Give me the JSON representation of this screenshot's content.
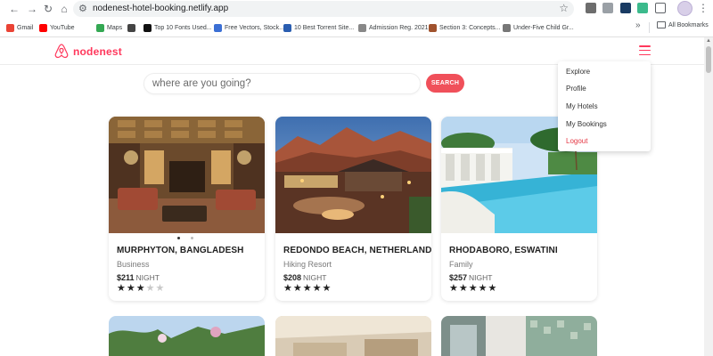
{
  "browser": {
    "url": "nodenest-hotel-booking.netlify.app",
    "bookmarks": [
      {
        "label": "Gmail",
        "color": "#ea4335"
      },
      {
        "label": "YouTube",
        "color": "#ff0000"
      },
      {
        "label": "Maps",
        "color": "#34a853"
      },
      {
        "label": "",
        "color": "#444444"
      },
      {
        "label": "Top 10 Fonts Used...",
        "color": "#111111"
      },
      {
        "label": "Free Vectors, Stock...",
        "color": "#3b6fd4"
      },
      {
        "label": "10 Best Torrent Site...",
        "color": "#2a5db0"
      },
      {
        "label": "Admission Reg. 2021",
        "color": "#888888"
      },
      {
        "label": "Section 3: Concepts...",
        "color": "#a0522d"
      },
      {
        "label": "Under-Five Child Gr...",
        "color": "#777777"
      }
    ],
    "all_bookmarks": "All Bookmarks",
    "more": "»"
  },
  "app": {
    "logo_text": "nodenest",
    "brand_color": "#ff385c"
  },
  "search": {
    "placeholder": "where are you going?",
    "button_label": "SEARCH"
  },
  "menu": {
    "items": [
      "Explore",
      "Profile",
      "My Hotels",
      "My Bookings",
      "Logout"
    ]
  },
  "hotels": [
    {
      "name": "MURPHYTON, BANGLADESH",
      "category": "Business",
      "price": "$211",
      "unit": "NIGHT",
      "rating": 3,
      "max_rating": 5
    },
    {
      "name": "REDONDO BEACH, NETHERLANDS",
      "category": "Hiking Resort",
      "price": "$208",
      "unit": "NIGHT",
      "rating": 5,
      "max_rating": 5
    },
    {
      "name": "RHODABORO, ESWATINI",
      "category": "Family",
      "price": "$257",
      "unit": "NIGHT",
      "rating": 5,
      "max_rating": 5
    }
  ],
  "carousel": {
    "active_index": 0,
    "count": 2
  }
}
